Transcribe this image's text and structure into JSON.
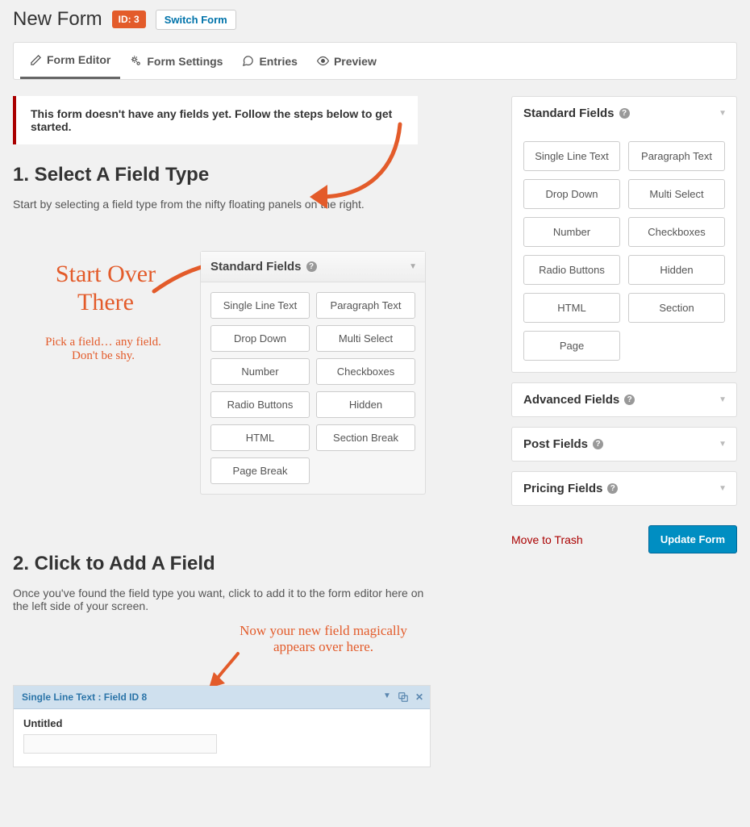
{
  "header": {
    "title": "New Form",
    "id_badge": "ID: 3",
    "switch": "Switch Form"
  },
  "tabs": {
    "editor": "Form Editor",
    "settings": "Form Settings",
    "entries": "Entries",
    "preview": "Preview"
  },
  "notice": "This form doesn't have any fields yet. Follow the steps below to get started.",
  "step1": {
    "heading": "1. Select A Field Type",
    "desc": "Start by selecting a field type from the nifty floating panels on the right.",
    "hand_big_l1": "Start Over",
    "hand_big_l2": "There",
    "hand_small_l1": "Pick a field… any field.",
    "hand_small_l2": "Don't be shy.",
    "panel_title": "Standard Fields",
    "fields": [
      "Single Line Text",
      "Paragraph Text",
      "Drop Down",
      "Multi Select",
      "Number",
      "Checkboxes",
      "Radio Buttons",
      "Hidden",
      "HTML",
      "Section Break",
      "Page Break"
    ]
  },
  "step2": {
    "heading": "2. Click to Add A Field",
    "desc": "Once you've found the field type you want, click to add it to the form editor here on the left side of your screen.",
    "hand_l1": "Now your new field magically",
    "hand_l2": "appears over here.",
    "row_label": "Single Line Text : Field ID 8",
    "field_label": "Untitled"
  },
  "sidebar": {
    "standard": {
      "title": "Standard Fields",
      "fields": [
        "Single Line Text",
        "Paragraph Text",
        "Drop Down",
        "Multi Select",
        "Number",
        "Checkboxes",
        "Radio Buttons",
        "Hidden",
        "HTML",
        "Section",
        "Page"
      ]
    },
    "advanced": "Advanced Fields",
    "post": "Post Fields",
    "pricing": "Pricing Fields"
  },
  "actions": {
    "trash": "Move to Trash",
    "update": "Update Form"
  }
}
